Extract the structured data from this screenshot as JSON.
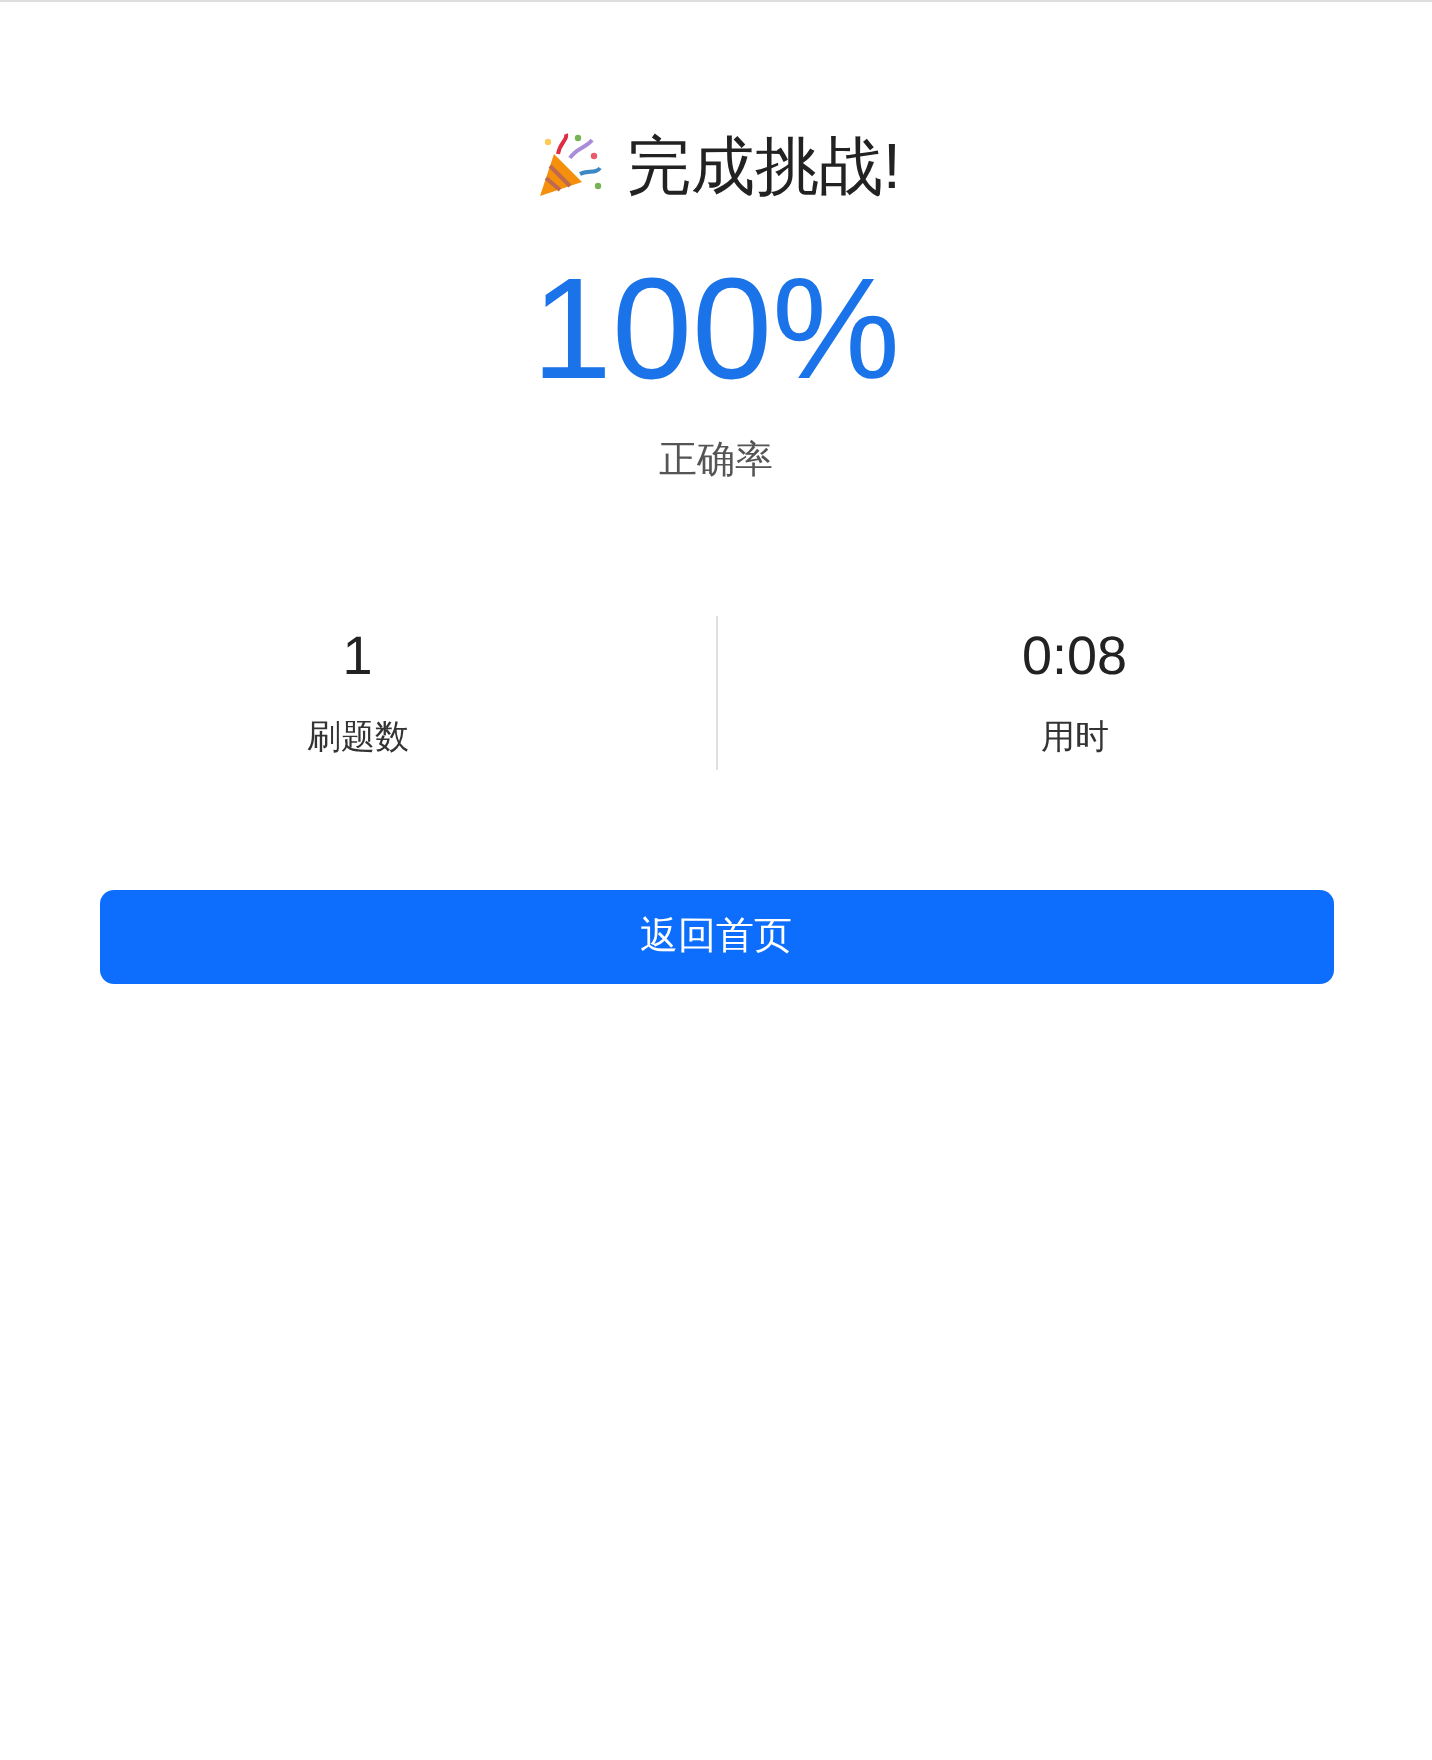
{
  "title": "完成挑战!",
  "accuracy": {
    "value": "100%",
    "label": "正确率"
  },
  "stats": [
    {
      "value": "1",
      "label": "刷题数"
    },
    {
      "value": "0:08",
      "label": "用时"
    }
  ],
  "button": "返回首页"
}
